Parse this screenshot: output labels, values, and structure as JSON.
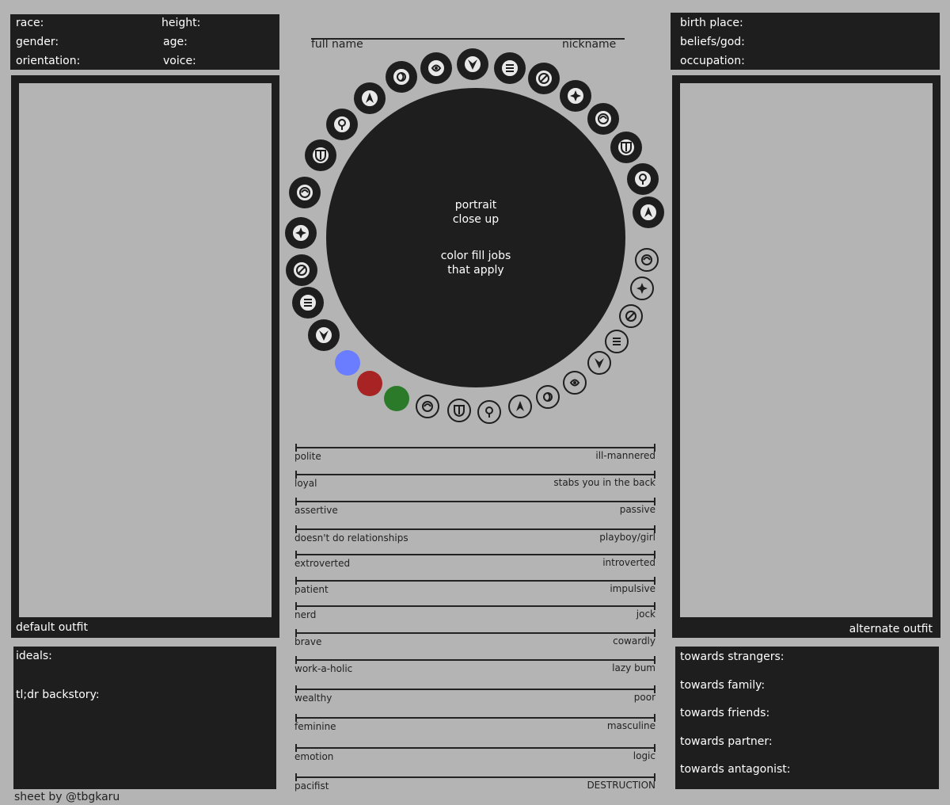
{
  "top_left": {
    "race": "race:",
    "height": "height:",
    "gender": "gender:",
    "age": "age:",
    "orientation": "orientation:",
    "voice": "voice:"
  },
  "top_right": {
    "birth_place": "birth place:",
    "beliefs": "beliefs/god:",
    "occupation": "occupation:"
  },
  "header": {
    "full_name": "full name",
    "nickname": "nickname"
  },
  "left_panel": {
    "label": "default outfit"
  },
  "right_panel": {
    "label": "alternate outfit"
  },
  "portrait": {
    "line1": "portrait",
    "line2": "close up",
    "line3": "color fill jobs",
    "line4": "that apply"
  },
  "bottom_left": {
    "ideals": "ideals:",
    "backstory": "tl;dr backstory:"
  },
  "bottom_right": {
    "strangers": "towards strangers:",
    "family": "towards family:",
    "friends": "towards friends:",
    "partner": "towards partner:",
    "antagonist": "towards antagonist:"
  },
  "credit": "sheet by @tbgkaru",
  "role_colors": {
    "tank": "#6a7cff",
    "dps": "#a82424",
    "healer": "#2a7a2a"
  },
  "scales": [
    {
      "left": "polite",
      "right": "ill-mannered"
    },
    {
      "left": "loyal",
      "right": "stabs you in the back"
    },
    {
      "left": "assertive",
      "right": "passive"
    },
    {
      "left": "doesn't do relationships",
      "right": "playboy/girl"
    },
    {
      "left": "extroverted",
      "right": "introverted"
    },
    {
      "left": "patient",
      "right": "impulsive"
    },
    {
      "left": "nerd",
      "right": "jock"
    },
    {
      "left": "brave",
      "right": "cowardly"
    },
    {
      "left": "work-a-holic",
      "right": "lazy bum"
    },
    {
      "left": "wealthy",
      "right": "poor"
    },
    {
      "left": "feminine",
      "right": "masculine"
    },
    {
      "left": "emotion",
      "right": "logic"
    },
    {
      "left": "pacifist",
      "right": "DESTRUCTION"
    }
  ],
  "job_icons": [
    "dragoon-icon",
    "sage-icon",
    "paladin-icon",
    "dark-knight-icon",
    "astrologian-icon",
    "samurai-icon",
    "monk-icon",
    "reaper-icon",
    "scholar-icon",
    "summoner-icon",
    "white-mage-icon",
    "ninja-icon",
    "black-mage-icon",
    "red-mage-icon",
    "dancer-icon",
    "machinist-icon",
    "bard-icon",
    "warrior-icon",
    "gunbreaker-icon"
  ],
  "crafter_icons": [
    "miner-icon",
    "fisher-icon",
    "botanist-icon",
    "culinarian-icon",
    "weaver-icon",
    "leatherworker-icon",
    "goldsmith-icon",
    "armorer-icon",
    "alchemist-icon",
    "blacksmith-icon",
    "carpenter-icon"
  ]
}
